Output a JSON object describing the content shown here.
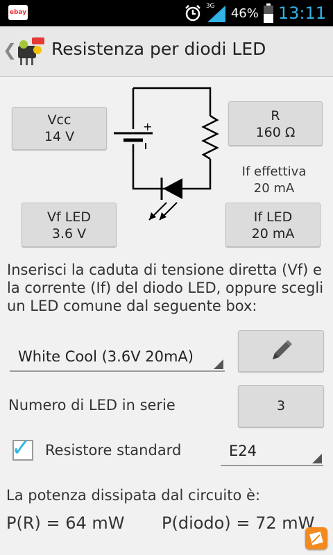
{
  "status": {
    "battery_pct": "46%",
    "network": "3G",
    "time": "13:11",
    "notif_app": "ebay"
  },
  "header": {
    "title": "Resistenza per diodi LED"
  },
  "circuit": {
    "vcc": {
      "label": "Vcc",
      "value": "14 V"
    },
    "r": {
      "label": "R",
      "value": "160 Ω"
    },
    "vf": {
      "label": "Vf LED",
      "value": "3.6 V"
    },
    "if": {
      "label": "If LED",
      "value": "20 mA"
    },
    "if_eff": {
      "label": "If effettiva",
      "value": "20 mA"
    },
    "battery_plus": "+"
  },
  "instructions": "Inserisci la caduta di tensione diretta (Vf) e la corrente (If) del diodo LED, oppure scegli un LED comune dal seguente box:",
  "led_select": {
    "value": "White Cool (3.6V 20mA)"
  },
  "series": {
    "label": "Numero di LED in serie",
    "value": "3"
  },
  "standard": {
    "label": "Resistore standard",
    "checked": true,
    "value": "E24"
  },
  "power": {
    "title": "La potenza dissipata dal circuito è:",
    "pr": "P(R) = 64 mW",
    "pd": "P(diodo) = 72 mW"
  },
  "colors": {
    "accent": "#33b5e5",
    "time": "#31b3e6"
  }
}
